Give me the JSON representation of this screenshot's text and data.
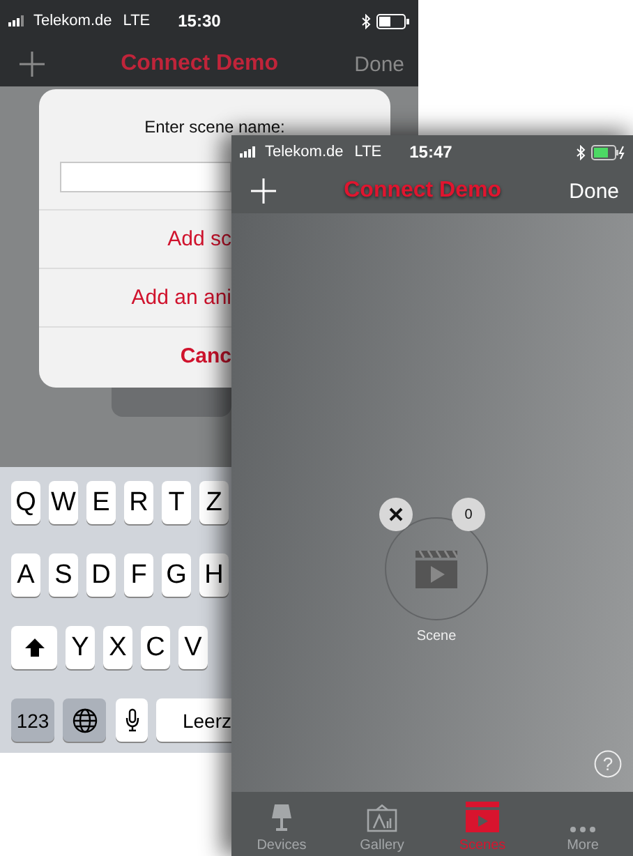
{
  "back_screen": {
    "status_bar": {
      "carrier": "Telekom.de",
      "network": "LTE",
      "time": "15:30",
      "charging": false
    },
    "nav_bar": {
      "title": "Connect Demo",
      "action": "Done",
      "dimmed": true
    },
    "dialog": {
      "title": "Enter scene name:",
      "actions": [
        {
          "label": "Add sc",
          "kind": "default"
        },
        {
          "label": "Add an ani",
          "kind": "default"
        },
        {
          "label": "Canc",
          "kind": "cancel"
        }
      ]
    },
    "keyboard": {
      "key_rows": [
        {
          "keys": [
            {
              "label": "Q",
              "kind": "letter"
            },
            {
              "label": "W",
              "kind": "letter"
            },
            {
              "label": "E",
              "kind": "letter"
            },
            {
              "label": "R",
              "kind": "letter"
            },
            {
              "label": "T",
              "kind": "letter"
            },
            {
              "label": "Z",
              "kind": "letter"
            }
          ]
        },
        {
          "keys": [
            {
              "label": "A",
              "kind": "letter"
            },
            {
              "label": "S",
              "kind": "letter"
            },
            {
              "label": "D",
              "kind": "letter"
            },
            {
              "label": "F",
              "kind": "letter"
            },
            {
              "label": "G",
              "kind": "letter"
            },
            {
              "label": "H",
              "kind": "letter"
            }
          ]
        },
        {
          "keys": [
            {
              "kind": "shift"
            },
            {
              "label": "Y",
              "kind": "letter"
            },
            {
              "label": "X",
              "kind": "letter"
            },
            {
              "label": "C",
              "kind": "letter"
            },
            {
              "label": "V",
              "kind": "letter"
            }
          ]
        },
        {
          "keys": [
            {
              "label": "123",
              "kind": "function"
            },
            {
              "kind": "globe"
            },
            {
              "kind": "mic"
            },
            {
              "label": "Leerz",
              "kind": "space"
            }
          ]
        }
      ]
    }
  },
  "front_screen": {
    "status_bar": {
      "carrier": "Telekom.de",
      "network": "LTE",
      "time": "15:47",
      "charging": true
    },
    "nav_bar": {
      "title": "Connect Demo",
      "action": "Done",
      "dimmed": false
    },
    "scenes": [
      {
        "name": "Scene",
        "count": "0"
      }
    ],
    "help_label": "?",
    "tabs": [
      {
        "label": "Devices",
        "kind": "devices",
        "selected": false
      },
      {
        "label": "Gallery",
        "kind": "gallery",
        "selected": false
      },
      {
        "label": "Scenes",
        "kind": "scenes",
        "selected": true
      },
      {
        "label": "More",
        "kind": "more",
        "selected": false
      }
    ]
  }
}
